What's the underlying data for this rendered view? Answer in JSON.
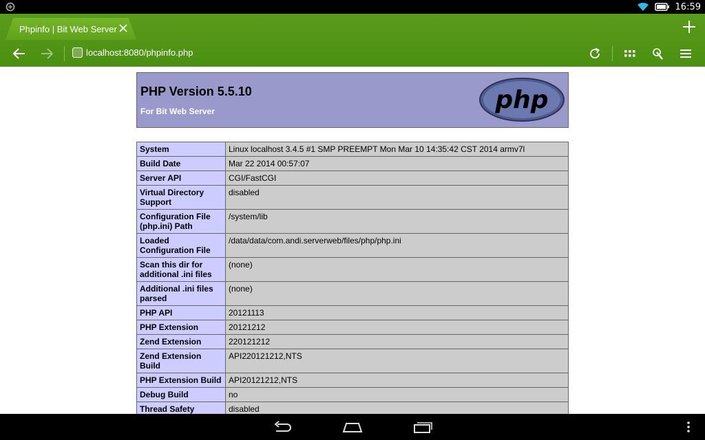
{
  "status_bar": {
    "time": "16:59",
    "icons": [
      "notification-icon",
      "wifi-icon",
      "battery-icon"
    ]
  },
  "browser": {
    "tab_title": "Phpinfo | Bit Web Server",
    "url": "localhost:8080/phpinfo.php",
    "accent": "#4b8f12",
    "icons": [
      "back-icon",
      "forward-icon",
      "page-icon",
      "reload-icon",
      "apps-grid-icon",
      "touch-icon",
      "menu-icon",
      "close-icon",
      "plus-icon"
    ]
  },
  "page": {
    "title": "PHP Version 5.5.10",
    "subtitle": "For Bit Web Server",
    "logo_text": "php",
    "header_color": "#9999cc",
    "rows": [
      {
        "key": "System",
        "value": "Linux localhost 3.4.5 #1 SMP PREEMPT Mon Mar 10 14:35:42 CST 2014 armv7l"
      },
      {
        "key": "Build Date",
        "value": "Mar 22 2014 00:57:07"
      },
      {
        "key": "Server API",
        "value": "CGI/FastCGI"
      },
      {
        "key": "Virtual Directory Support",
        "value": "disabled"
      },
      {
        "key": "Configuration File (php.ini) Path",
        "value": "/system/lib"
      },
      {
        "key": "Loaded Configuration File",
        "value": "/data/data/com.andi.serverweb/files/php/php.ini"
      },
      {
        "key": "Scan this dir for additional .ini files",
        "value": "(none)"
      },
      {
        "key": "Additional .ini files parsed",
        "value": "(none)"
      },
      {
        "key": "PHP API",
        "value": "20121113"
      },
      {
        "key": "PHP Extension",
        "value": "20121212"
      },
      {
        "key": "Zend Extension",
        "value": "220121212"
      },
      {
        "key": "Zend Extension Build",
        "value": "API220121212,NTS"
      },
      {
        "key": "PHP Extension Build",
        "value": "API20121212,NTS"
      },
      {
        "key": "Debug Build",
        "value": "no"
      },
      {
        "key": "Thread Safety",
        "value": "disabled"
      }
    ]
  },
  "nav_bar": {
    "icons": [
      "back-nav-icon",
      "home-nav-icon",
      "recents-nav-icon",
      "overflow-icon"
    ]
  }
}
